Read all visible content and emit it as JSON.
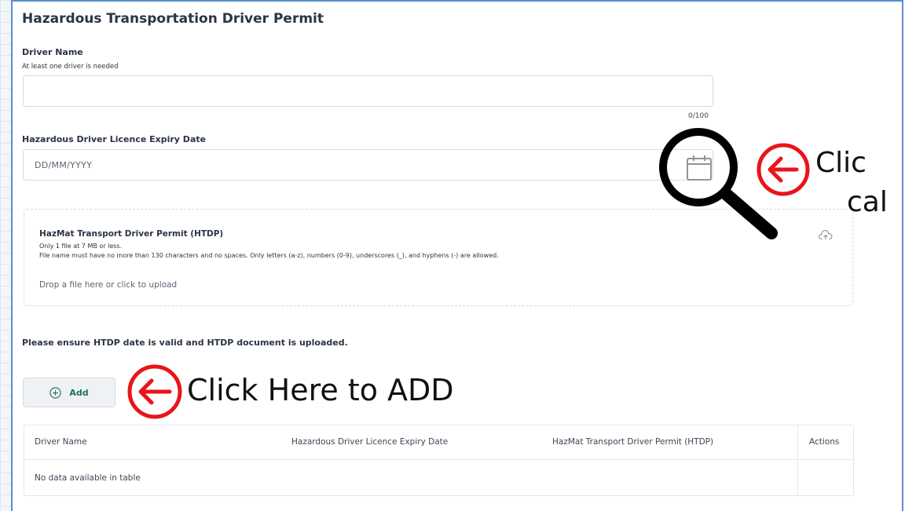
{
  "form": {
    "title": "Hazardous Transportation Driver Permit",
    "driver_name": {
      "label": "Driver Name",
      "hint": "At least one driver is needed",
      "value": "",
      "counter": "0/100"
    },
    "expiry_date": {
      "label": "Hazardous Driver Licence Expiry Date",
      "placeholder": "DD/MM/YYYY"
    },
    "upload": {
      "title": "HazMat Transport Driver Permit (HTDP)",
      "rule_1": "Only 1 file at 7 MB or less.",
      "rule_2": "File name must have no more than 130 characters and no spaces. Only letters (a-z), numbers (0-9), underscores (_), and hyphens (-) are allowed.",
      "drop_text": "Drop a file here or click to upload"
    },
    "notice": "Please ensure HTDP date is valid and HTDP document is uploaded.",
    "add_label": "Add"
  },
  "table": {
    "columns": [
      "Driver Name",
      "Hazardous Driver Licence Expiry Date",
      "HazMat Transport Driver Permit (HTDP)",
      "Actions"
    ],
    "empty_text": "No data available in table"
  },
  "annotations": {
    "calendar_text_line1": "Clic",
    "calendar_text_line2": "cal",
    "add_text": "Click Here to ADD",
    "accent_color": "#e8151b"
  }
}
